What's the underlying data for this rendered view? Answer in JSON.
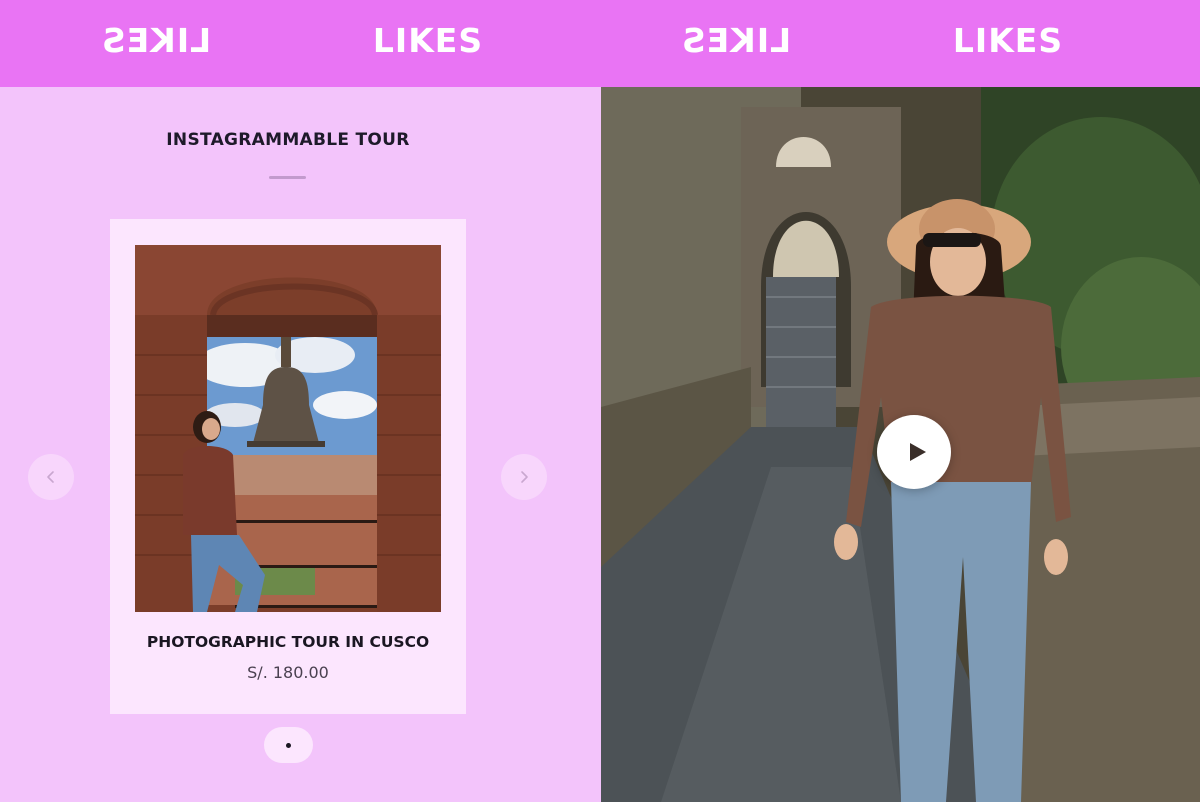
{
  "marquee": {
    "logo_text": "LIKES",
    "logo_color": "#ffffff",
    "background": "#e974f4"
  },
  "section": {
    "title": "INSTAGRAMMABLE TOUR"
  },
  "products": [
    {
      "name": "PHOTOGRAPHIC TOUR IN CUSCO",
      "price": "S/. 180.00",
      "image": "woman-in-bell-tower-cusco"
    }
  ],
  "carousel": {
    "prev_icon": "chevron-left-icon",
    "next_icon": "chevron-right-icon",
    "pages": 1,
    "active_page": 1
  },
  "video": {
    "image": "woman-walking-stone-path",
    "play_icon": "play-icon"
  },
  "colors": {
    "panel_bg": "#f3c4fb",
    "card_bg": "#fce6fe",
    "text_dark": "#1a1622"
  }
}
